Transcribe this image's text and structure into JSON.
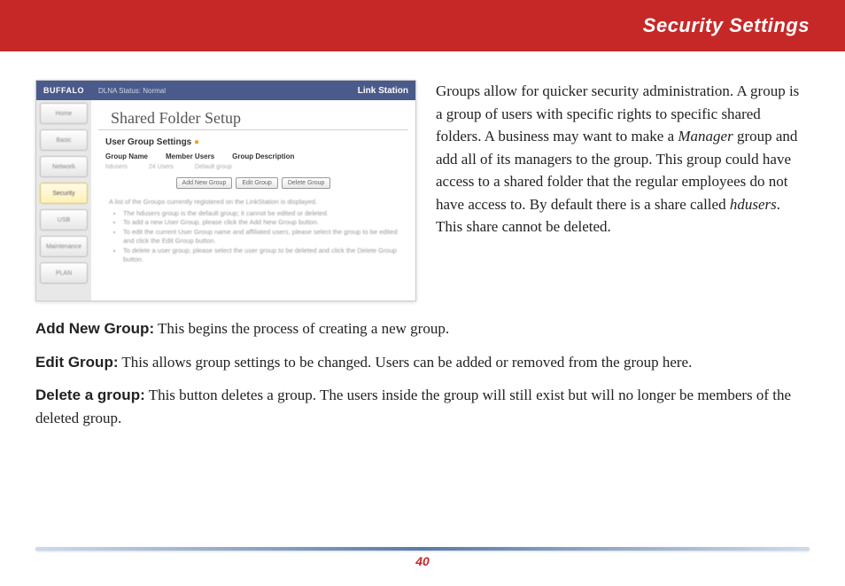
{
  "header": {
    "title": "Security Settings"
  },
  "screenshot": {
    "brand": "BUFFALO",
    "status": "DLNA Status: Normal",
    "product": "Link Station",
    "nav": [
      "Home",
      "Basic",
      "Network",
      "Security",
      "USB",
      "Maintenance",
      "PLAN"
    ],
    "panelTitle": "Shared Folder Setup",
    "sectionTitle": "User Group Settings",
    "columns": {
      "c1": "Group Name",
      "c2": "Member Users",
      "c3": "Group Description"
    },
    "row": {
      "c1": "hdusers",
      "c2": "24 Users",
      "c3": "Default group"
    },
    "buttons": {
      "b1": "Add New Group",
      "b2": "Edit Group",
      "b3": "Delete Group"
    },
    "desc": "A list of the Groups currently registered on the LinkStation is displayed.",
    "bullets": {
      "b1": "The hdusers group is the default group; it cannot be edited or deleted.",
      "b2": "To add a new User Group, please click the Add New Group button.",
      "b3": "To edit the current User Group name and affiliated users, please select the group to be edited and click the Edit Group button.",
      "b4": "To delete a user group, please select the user group to be deleted and click the Delete Group button."
    }
  },
  "intro": {
    "p1a": "Groups allow for quicker security administration.  A group is a group of users with specific rights to specific shared folders.  A business may want to make a ",
    "p1b": "Manager",
    "p1c": " group and add all of its managers to the group.  This group could have access to a shared folder that the regular employees do not have access to.  By default there is a share called ",
    "p1d": "hdusers",
    "p1e": ".  This share cannot be deleted."
  },
  "definitions": {
    "d1": {
      "label": "Add New Group:",
      "text": "  This begins the process of creating a new group."
    },
    "d2": {
      "label": "Edit Group:",
      "text": "  This allows group settings to be changed.  Users can be added or removed from the group here."
    },
    "d3": {
      "label": "Delete a group:",
      "text": "  This button deletes a group.  The users inside the group will still exist but will no longer be members of the deleted group."
    }
  },
  "pageNumber": "40"
}
